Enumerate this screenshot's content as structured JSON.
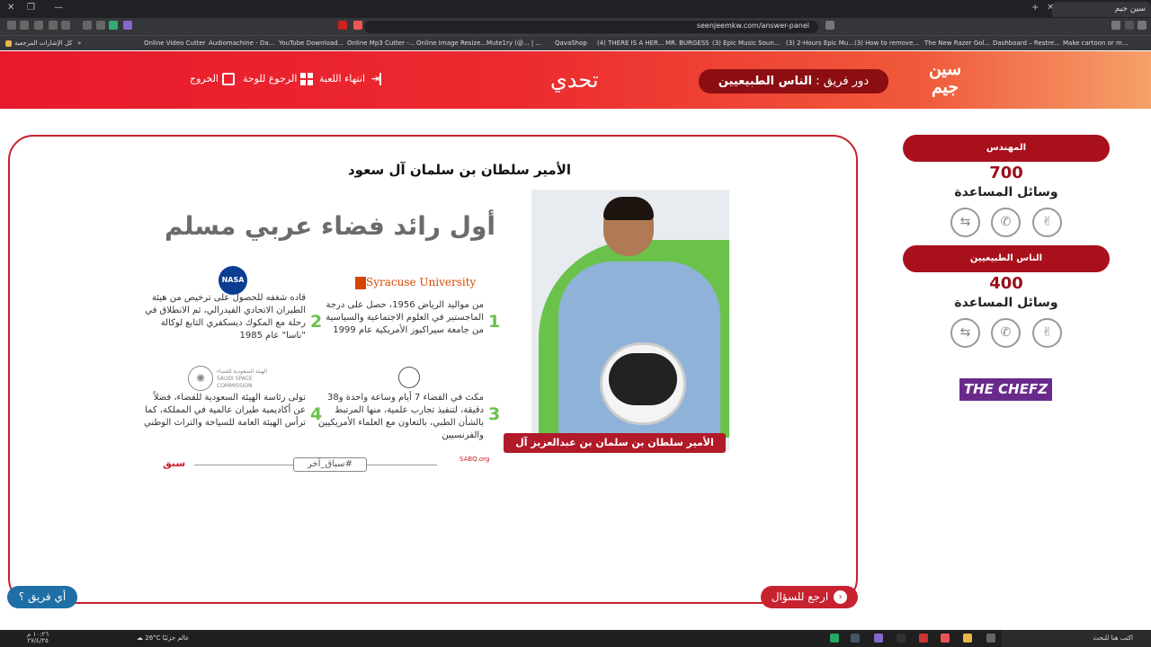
{
  "browser": {
    "tab_title": "سين جيم",
    "url": "seenjeemkw.com/answer-panel",
    "bookmarks": [
      "Online Video Cutter",
      "Audiomachine - Da...",
      "YouTube Download...",
      "Online Mp3 Cutter -...",
      "Online Image Resize...",
      "Mute1ry (@... | ...",
      "QavaShop",
      "(4) THERE IS A HER...",
      "MR. BURGESS",
      "(3) Epic Music Soun...",
      "(3) 2-Hours Epic Mu...",
      "(3) How to remove...",
      "The New Razer Gol...",
      "Dashboard – Restre...",
      "Make cartoon or m..."
    ],
    "bookmarks_all": "كل الإشارات المرجعية",
    "bookmark_extra": "موازيكا"
  },
  "header": {
    "logo_line1": "سين",
    "logo_line2": "جيم",
    "team_turn_prefix": "دور فريق :",
    "team_turn_name": "الناس الطبيعيين",
    "title": "تحدي",
    "nav_end_game": "انتهاء اللعبة",
    "nav_back_board": "الرجوع للوحة",
    "nav_exit": "الخروج"
  },
  "question": {
    "title": "الأمير سلطان بن سلمان آل سعود"
  },
  "infographic": {
    "headline": "أول رائد فضاء عربي مسلم",
    "photo_caption": "الأمير سلطان بن سلمان بن عبدالعزيز آل سعود",
    "items": [
      {
        "num": "1",
        "text": "من مواليد الرياض 1956، حصل على درجة الماجستير في العلوم الاجتماعية والسياسية من جامعة سيراكيوز الأمريكية عام 1999"
      },
      {
        "num": "2",
        "text": "قاده شغفه للحصول على ترخيص من هيئة الطيران الاتحادي الفيدرالي، ثم الانطلاق في رحلة مع المكوك ديسكفري التابع لوكالة \"ناسا\" عام 1985"
      },
      {
        "num": "3",
        "text": "مكث في الفضاء 7 أيام وساعة واحدة و38 دقيقة، لتنفيذ تجارب علمية، منها المرتبط بالشأن الطبي، بالتعاون مع العلماء الأمريكيين والفرنسيين"
      },
      {
        "num": "4",
        "text": "تولى رئاسة الهيئة السعودية للفضاء، فضلاً عن أكاديمية طيران عالمية في المملكة، كما ترأس الهيئة العامة للسياحة والتراث الوطني"
      }
    ],
    "syracuse": "Syracuse University",
    "nasa": "NASA",
    "ssc_ar": "الهيئة السعودية للفضاء",
    "ssc_en": "SAUDI SPACE COMMISSION",
    "hashtag": "#سباق_آخر",
    "sabq": "SABQ.org",
    "brand_mark": "سبق"
  },
  "actions": {
    "which_team": "أي فريق ؟",
    "back_to_question": "ارجع للسؤال"
  },
  "teams": [
    {
      "name": "المهندس",
      "score": "700",
      "aids_label": "وسائل المساعدة"
    },
    {
      "name": "الناس الطبيعيين",
      "score": "400",
      "aids_label": "وسائل المساعدة"
    }
  ],
  "sponsor": "THE CHEFZ",
  "taskbar": {
    "temp": "26°C",
    "weather": "عالم جزئيًا",
    "search": "اكتب هنا للبحث",
    "time": "١٠:٢٦ م",
    "date": "٢٧/٤/٢٥"
  }
}
